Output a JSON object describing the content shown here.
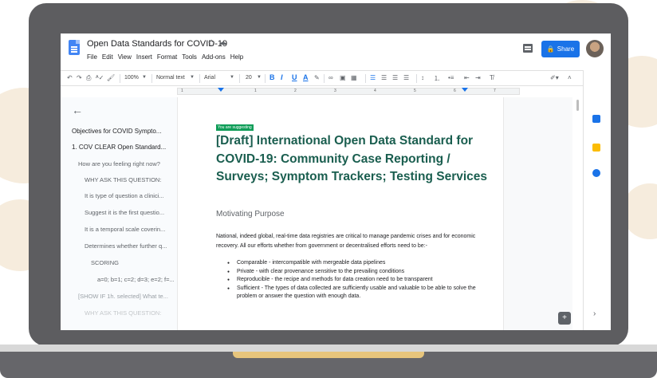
{
  "app": {
    "doc_title": "Open Data Standards for COVID-19",
    "menu": [
      "File",
      "Edit",
      "View",
      "Insert",
      "Format",
      "Tools",
      "Add-ons",
      "Help"
    ],
    "share_label": "Share",
    "brand_color": "#1a73e8"
  },
  "toolbar": {
    "zoom": "100%",
    "style": "Normal text",
    "font": "Arial",
    "font_size": "20",
    "bold": "B",
    "italic": "I",
    "underline": "U",
    "text_color": "A"
  },
  "ruler": {
    "numbers": [
      "1",
      "1",
      "2",
      "3",
      "4",
      "5",
      "6",
      "7"
    ]
  },
  "outline": {
    "items": [
      "Objectives for COVID Sympto...",
      "1. COV CLEAR Open Standard...",
      "How are you feeling right now?",
      "WHY ASK THIS QUESTION:",
      "It is type of question a clinici...",
      "Suggest it is the first questio...",
      "It is a temporal scale coverin...",
      "Determines whether further q...",
      "SCORING",
      "a=0; b=1; c=2; d=3; e=2; f=...",
      "[SHOW IF 1h. selected] What te...",
      "WHY ASK THIS QUESTION:"
    ]
  },
  "document": {
    "suggest_tag": "You are suggesting",
    "title": "[Draft] International Open Data Standard for COVID-19: Community Case Reporting / Surveys; Symptom Trackers; Testing Services",
    "heading": "Motivating Purpose",
    "paragraph": "National, indeed global, real-time data registries are critical to manage pandemic crises and for economic recovery. All our efforts whether from government or decentralised efforts need to be:-",
    "bullets": [
      "Comparable - intercompatible with mergeable data pipelines",
      "Private - with clear provenance sensitive to the prevailing conditions",
      "Reproducible - the recipe and methods for data creation need to be transparent",
      "Sufficient - The types of data collected are sufficiently usable and valuable to be able to solve the problem or answer the question with enough data."
    ],
    "heading_color": "#1a5e4f"
  },
  "icons": [
    "docs-logo-icon",
    "star-icon",
    "cloud-icon",
    "comment-icon",
    "lock-icon",
    "undo-icon",
    "redo-icon",
    "print-icon",
    "spellcheck-icon",
    "paint-format-icon",
    "link-icon",
    "insert-comment-icon",
    "image-icon",
    "align-left-icon",
    "align-center-icon",
    "align-right-icon",
    "justify-icon",
    "line-spacing-icon",
    "numbered-list-icon",
    "bulleted-list-icon",
    "indent-decrease-icon",
    "indent-increase-icon",
    "clear-format-icon",
    "editing-mode-icon",
    "collapse-icon",
    "back-arrow-icon",
    "calendar-icon",
    "keep-icon",
    "tasks-icon",
    "expand-panel-icon",
    "explore-icon"
  ]
}
